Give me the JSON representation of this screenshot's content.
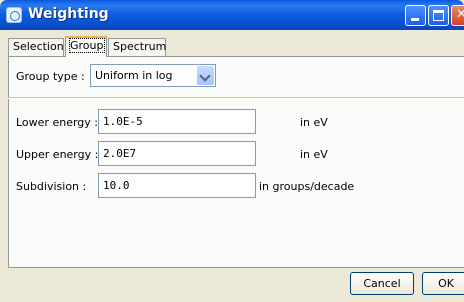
{
  "window": {
    "title": "Weighting"
  },
  "tabs": [
    {
      "label": "Selection",
      "selected": false
    },
    {
      "label": "Group",
      "selected": true
    },
    {
      "label": "Spectrum",
      "selected": false
    }
  ],
  "group_type": {
    "label": "Group type :",
    "value": "Uniform in log"
  },
  "fields": [
    {
      "label": "Lower energy :",
      "value": "1.0E-5",
      "unit": "in eV"
    },
    {
      "label": "Upper energy :",
      "value": "2.0E7",
      "unit": "in eV"
    },
    {
      "label": "Subdivision :",
      "value": "10.0",
      "unit": "in groups/decade"
    }
  ],
  "buttons": {
    "cancel": "Cancel",
    "ok": "OK"
  },
  "icons": {
    "window": "weighting-app-icon",
    "minimize": "minimize-icon",
    "maximize": "maximize-icon",
    "close": "close-icon",
    "dropdown": "chevron-down-icon"
  },
  "colors": {
    "titlebar": "#0a5ae3",
    "window_bg": "#ece9d8",
    "close_button": "#d3411f",
    "tab_highlight": "#f5b04e"
  }
}
